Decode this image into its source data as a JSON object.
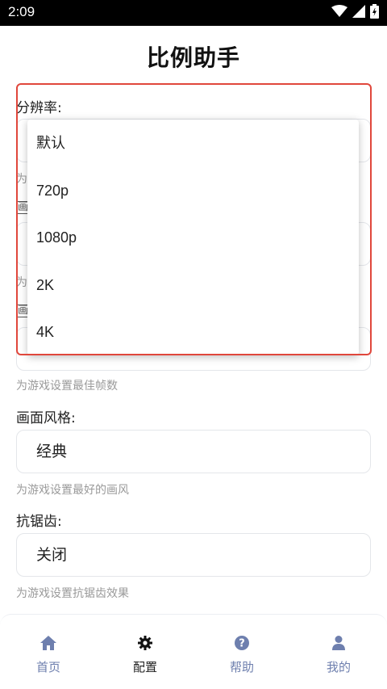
{
  "status_bar": {
    "time": "2:09",
    "icons": [
      "wifi-icon",
      "cellular-icon",
      "battery-icon"
    ]
  },
  "page_title": "比例助手",
  "settings": {
    "resolution": {
      "label": "分辨率:",
      "options": [
        "默认",
        "720p",
        "1080p",
        "2K",
        "4K"
      ]
    },
    "fps_hint": "为游戏设置最佳帧数",
    "partial_hint_1": "为",
    "partial_hint_2": "为",
    "partial_box_1": "画",
    "partial_box_2": "画",
    "style": {
      "label": "画面风格:",
      "value": "经典",
      "hint": "为游戏设置最好的画风"
    },
    "antialias": {
      "label": "抗锯齿:",
      "value": "关闭",
      "hint": "为游戏设置抗锯齿效果"
    }
  },
  "nav": {
    "items": [
      {
        "label": "首页",
        "icon": "home-icon",
        "active": false
      },
      {
        "label": "配置",
        "icon": "gear-icon",
        "active": true
      },
      {
        "label": "帮助",
        "icon": "help-icon",
        "active": false
      },
      {
        "label": "我的",
        "icon": "user-icon",
        "active": false
      }
    ]
  },
  "colors": {
    "highlight": "#e0473c",
    "nav_inactive": "#6e7fae",
    "nav_active": "#222222"
  }
}
